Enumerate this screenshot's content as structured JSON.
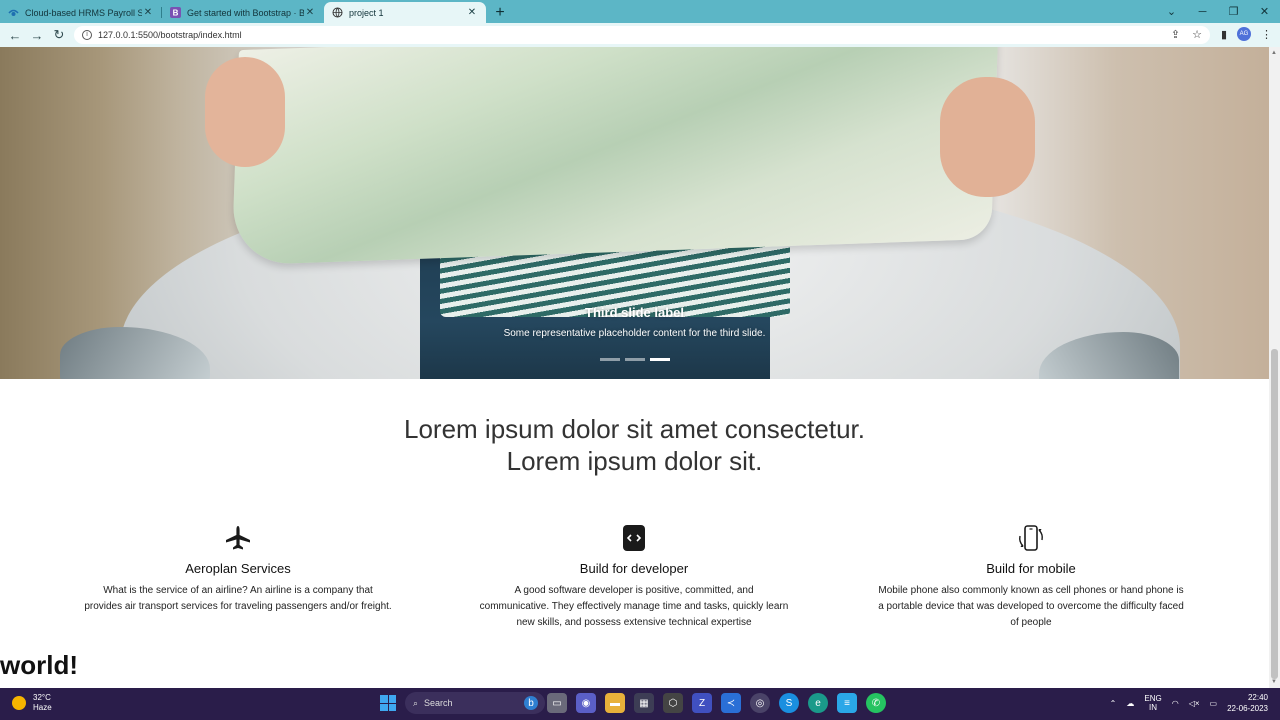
{
  "browser": {
    "tabs": [
      {
        "title": "Cloud-based HRMS Payroll Softw",
        "icon": "hrms-icon",
        "active": false
      },
      {
        "title": "Get started with Bootstrap · Boot",
        "icon": "bootstrap-icon",
        "active": false
      },
      {
        "title": "project 1",
        "icon": "globe-icon",
        "active": true
      }
    ],
    "new_tab": "+",
    "url": "127.0.0.1:5500/bootstrap/index.html",
    "avatar_initials": "AG"
  },
  "carousel": {
    "caption_title": "Third slide label",
    "caption_text": "Some representative placeholder content for the third slide.",
    "slide_count": 3,
    "active_slide": 3
  },
  "lead": {
    "line1": "Lorem ipsum dolor sit amet consectetur.",
    "line2": "Lorem ipsum dolor sit."
  },
  "features": [
    {
      "title": "Aeroplan Services",
      "icon": "airplane-icon",
      "text": "What is the service of an airline? An airline is a company that provides air transport services for traveling passengers and/or freight."
    },
    {
      "title": "Build for developer",
      "icon": "code-icon",
      "text": "A good software developer is positive, committed, and communicative. They effectively manage time and tasks, quickly learn new skills, and possess extensive technical expertise"
    },
    {
      "title": "Build for mobile",
      "icon": "phone-rotate-icon",
      "text": "Mobile phone also commonly known as cell phones or hand phone is a portable device that was developed to overcome the difficulty faced of people"
    }
  ],
  "heading_world": "world!",
  "taskbar": {
    "temperature": "32°C",
    "weather": "Haze",
    "search_placeholder": "Search",
    "lang_top": "ENG",
    "lang_bottom": "IN",
    "time": "22:40",
    "date": "22-06-2023"
  },
  "colors": {
    "tabbar": "#5cb6c6",
    "taskbar": "#2a1d4a",
    "accent": "#4f71d9"
  }
}
